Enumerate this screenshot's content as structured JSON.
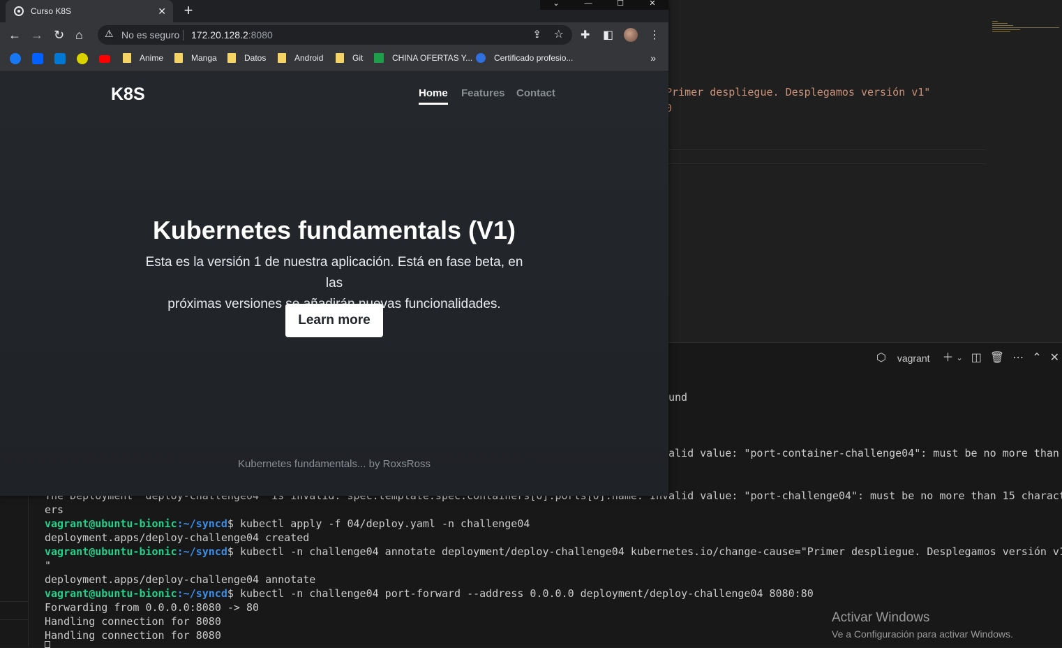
{
  "chrome": {
    "tab_title": "Curso K8S",
    "tab_close": "✕",
    "new_tab": "+",
    "window_controls": [
      "⌄",
      "—",
      "☐",
      "✕"
    ],
    "nav_icons": [
      "back-icon",
      "forward-icon",
      "reload-icon",
      "home-icon"
    ],
    "security_text": "No es seguro",
    "url_host": "172.20.128.2",
    "url_port": ":8080",
    "bookmarks": [
      "Anime",
      "Manga",
      "Datos",
      "Android",
      "Git",
      "CHINA OFERTAS Y...",
      "Certificado profesio..."
    ],
    "bookmarks_more": "»"
  },
  "page": {
    "brand": "K8S",
    "nav": [
      "Home",
      "Features",
      "Contact"
    ],
    "hero_title": "Kubernetes fundamentals (V1)",
    "hero_line1": "Esta es la versión 1 de nuestra aplicación. Está en fase beta, en las",
    "hero_line2": "próximas versiones se añadirán nuevas funcionalidades.",
    "button": "Learn more",
    "footer": "Kubernetes fundamentals... by RoxsRoss"
  },
  "editor": {
    "line1": "Primer despliegue. Desplegamos versión v1\"",
    "line2": "0"
  },
  "panel": {
    "terminal_name": "vagrant"
  },
  "terminal": {
    "partial1": "und",
    "partial2": "alid value: \"port-container-challenge04\": must be no more than",
    "line_err": "The Deployment \"deploy-challenge04\" is invalid: spec.template.spec.containers[0].ports[0].name: Invalid value: \"port-challenge04\": must be no more than 15 charact",
    "line_err2": "ers",
    "user": "vagrant@ubuntu-bionic",
    "path": ":~/syncd",
    "cmd1": "$ kubectl apply -f 04/deploy.yaml -n challenge04",
    "out1": "deployment.apps/deploy-challenge04 created",
    "cmd2": "$ kubectl -n challenge04 annotate deployment/deploy-challenge04 kubernetes.io/change-cause=\"Primer despliegue. Desplegamos versión v1",
    "cmd2_cont": "\"",
    "out2": "deployment.apps/deploy-challenge04 annotate",
    "cmd3": "$ kubectl -n challenge04 port-forward --address 0.0.0.0 deployment/deploy-challenge04 8080:80",
    "out3": "Forwarding from 0.0.0.0:8080 -> 80",
    "out4": "Handling connection for 8080",
    "out5": "Handling connection for 8080"
  },
  "watermark": {
    "title": "Activar Windows",
    "subtitle": "Ve a Configuración para activar Windows."
  }
}
